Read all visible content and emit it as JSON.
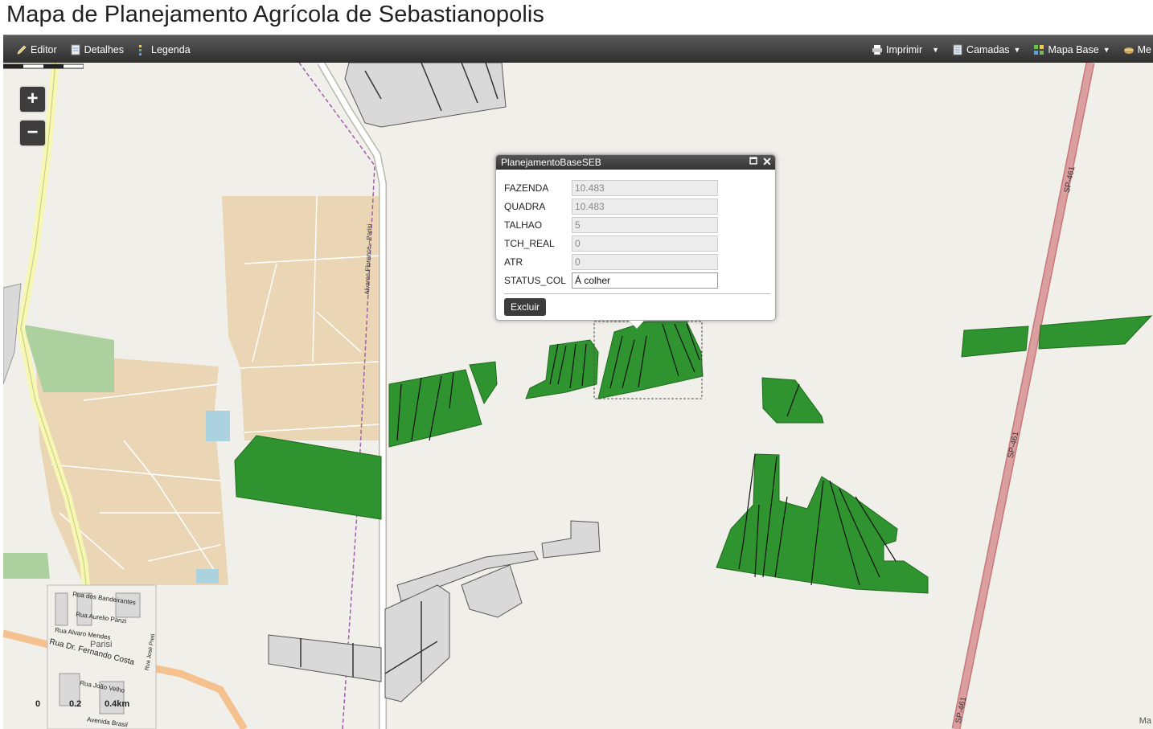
{
  "app_title": "Mapa de Planejamento Agrícola de Sebastianopolis",
  "toolbar": {
    "editor": "Editor",
    "details": "Detalhes",
    "legend": "Legenda",
    "print": "Imprimir",
    "layers": "Camadas",
    "basemap": "Mapa Base",
    "more": "Me"
  },
  "map": {
    "zoom_in": "+",
    "zoom_out": "−",
    "labels": {
      "road_main": "SP-461",
      "road_rural": "Alvares Florence—Parisi",
      "town": "Parisi",
      "street_1": "Rua dos Bandeirantes",
      "street_2": "Rua Aurelio Panzi",
      "street_3": "Rua Alvaro Mendes",
      "street_4": "Rua Dr. Fernando Costa",
      "street_5": "Rua José Preti",
      "street_6": "Rua João Velho",
      "street_7": "Avenida Brasil"
    },
    "scale": {
      "l0": "0",
      "l1": "0.2",
      "l2": "0.4km"
    },
    "attribution": "Ma",
    "colors": {
      "field": "#2f942f",
      "selected_outline": "#666666",
      "road": "#d59a9a",
      "urban": "#ead6b5"
    }
  },
  "popup": {
    "title": "PlanejamentoBaseSEB",
    "fields": [
      {
        "label": "FAZENDA",
        "value": "10.483"
      },
      {
        "label": "QUADRA",
        "value": "10.483"
      },
      {
        "label": "TALHAO",
        "value": "5"
      },
      {
        "label": "TCH_REAL",
        "value": "0"
      },
      {
        "label": "ATR",
        "value": "0"
      },
      {
        "label": "STATUS_COL",
        "value": "Á colher"
      }
    ],
    "delete_label": "Excluir"
  }
}
